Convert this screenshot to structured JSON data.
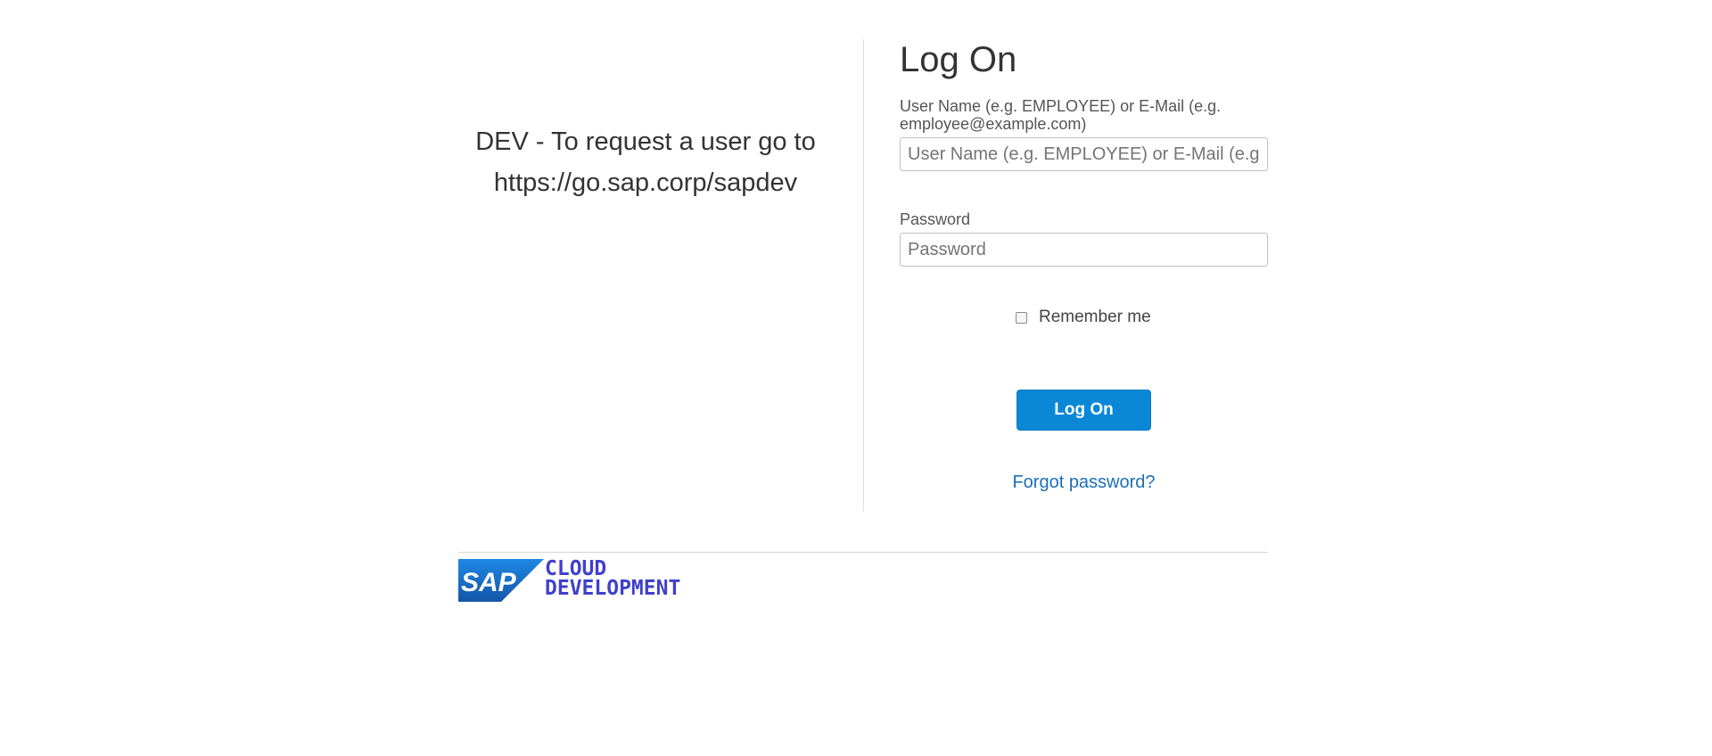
{
  "info": {
    "line1": "DEV - To request a user go to",
    "line2": "https://go.sap.corp/sapdev"
  },
  "form": {
    "title": "Log On",
    "username_label": "User Name (e.g. EMPLOYEE) or E-Mail (e.g. employee@example.com)",
    "username_placeholder": "User Name (e.g. EMPLOYEE) or E-Mail (e.g. employee@example.com)",
    "username_value": "",
    "password_label": "Password",
    "password_placeholder": "Password",
    "password_value": "",
    "remember_label": "Remember me",
    "remember_checked": false,
    "logon_button_label": "Log On",
    "forgot_link": "Forgot password?"
  },
  "footer": {
    "logo_brand": "SAP",
    "logo_line1": "CLOUD",
    "logo_line2": "DEVELOPMENT"
  },
  "colors": {
    "primary_button": "#0a88d6",
    "link": "#1c6fb7",
    "logo_text": "#4040cc",
    "sap_blue": "#1a70c4"
  }
}
